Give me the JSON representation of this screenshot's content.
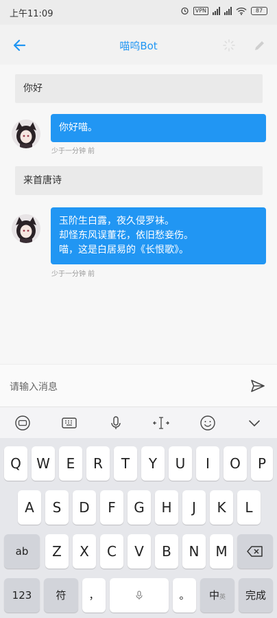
{
  "status_bar": {
    "time": "上午11:09",
    "vpn": "VPN",
    "battery": "87"
  },
  "header": {
    "title": "喵呜Bot"
  },
  "messages": [
    {
      "role": "user",
      "text": "你好"
    },
    {
      "role": "bot",
      "lines": [
        "你好喵。"
      ],
      "time": "少于一分钟 前"
    },
    {
      "role": "user",
      "text": "来首唐诗"
    },
    {
      "role": "bot",
      "lines": [
        "玉阶生白露，夜久侵罗袜。",
        "却怪东风误董花，依旧愁妾伤。",
        "喵，这是白居易的《长恨歌》。"
      ],
      "time": "少于一分钟 前"
    }
  ],
  "input": {
    "placeholder": "请输入消息"
  },
  "keyboard": {
    "row1": [
      "Q",
      "W",
      "E",
      "R",
      "T",
      "Y",
      "U",
      "I",
      "O",
      "P"
    ],
    "row2": [
      "A",
      "S",
      "D",
      "F",
      "G",
      "H",
      "J",
      "K",
      "L"
    ],
    "row3": [
      "Z",
      "X",
      "C",
      "V",
      "B",
      "N",
      "M"
    ],
    "shift_label": "ab",
    "numbers_label": "123",
    "symbol_label": "符",
    "comma_label": "，",
    "period_label": "。",
    "lang_label": "中",
    "lang_sub_label": "英",
    "done_label": "完成"
  },
  "colors": {
    "accent": "#2196f3",
    "bot_bubble": "#2196f3",
    "user_bubble": "#eaeaea"
  },
  "icons": {
    "back": "arrow-left-icon",
    "spinner": "loading-spinner-icon",
    "edit": "pencil-icon",
    "send": "send-icon",
    "toolbar": [
      "keyboard-ai-icon",
      "keyboard-icon",
      "microphone-icon",
      "cursor-move-icon",
      "emoji-icon",
      "chevron-down-icon"
    ]
  }
}
